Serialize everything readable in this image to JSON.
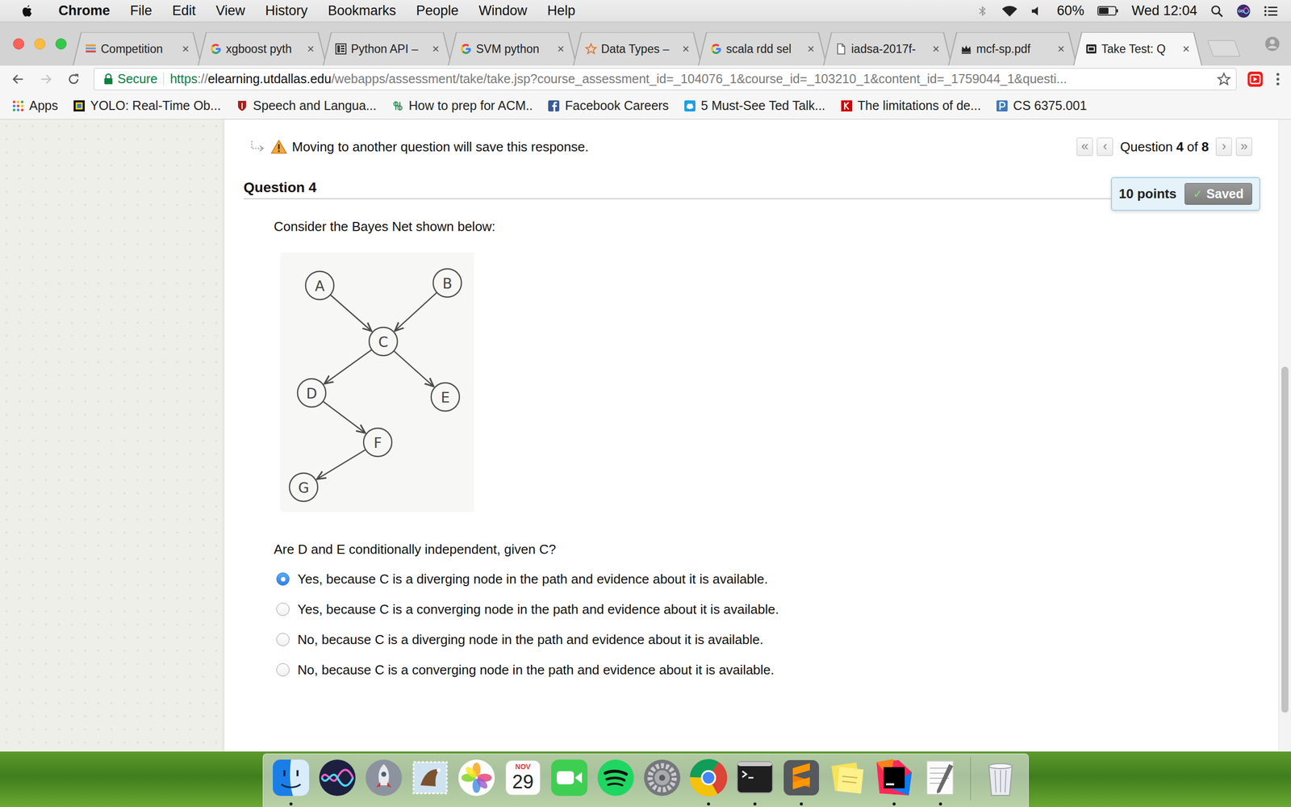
{
  "menu_bar": {
    "app_name": "Chrome",
    "menus": [
      "File",
      "Edit",
      "View",
      "History",
      "Bookmarks",
      "People",
      "Window",
      "Help"
    ],
    "battery": "60%",
    "battery_level": 0.6,
    "clock": "Wed 12:04"
  },
  "tab_close": "×",
  "tabs": [
    {
      "label": "Competition",
      "kind": "kaggle",
      "selected": false
    },
    {
      "label": "xgboost pyth",
      "kind": "google",
      "selected": false
    },
    {
      "label": "Python API –",
      "kind": "docs",
      "selected": false
    },
    {
      "label": "SVM python",
      "kind": "google",
      "selected": false
    },
    {
      "label": "Data Types –",
      "kind": "star",
      "selected": false
    },
    {
      "label": "scala rdd sel",
      "kind": "google",
      "selected": false
    },
    {
      "label": "iadsa-2017f-",
      "kind": "file",
      "selected": false
    },
    {
      "label": "mcf-sp.pdf",
      "kind": "crown",
      "selected": false
    },
    {
      "label": "Take Test: Q",
      "kind": "blackboard",
      "selected": true
    }
  ],
  "toolbar": {
    "secure_label": "Secure",
    "url_scheme": "https",
    "url_separator": "://",
    "url_host": "elearning.utdallas.edu",
    "url_rest": "/webapps/assessment/take/take.jsp?course_assessment_id=_104076_1&course_id=_103210_1&content_id=_1759044_1&questi..."
  },
  "bookmarks": [
    {
      "label": "Apps",
      "kind": "apps"
    },
    {
      "label": "YOLO: Real-Time Ob...",
      "kind": "yolo"
    },
    {
      "label": "Speech and Langua...",
      "kind": "stanford"
    },
    {
      "label": "How to prep for ACM..",
      "kind": "knot"
    },
    {
      "label": "Facebook Careers",
      "kind": "facebook"
    },
    {
      "label": "5 Must-See Ted Talk...",
      "kind": "cloud"
    },
    {
      "label": "The limitations of de...",
      "kind": "keras"
    },
    {
      "label": "CS 6375.001",
      "kind": "piazza"
    }
  ],
  "page": {
    "notice": "Moving to another question will save this response.",
    "nav": {
      "first": "«",
      "prev": "‹",
      "prefix": "Question",
      "current": "4",
      "of": "of",
      "total": "8",
      "next": "›",
      "last": "»"
    },
    "question_title": "Question 4",
    "points": "10 points",
    "saved_check": "✓",
    "saved_label": "Saved",
    "prompt": "Consider the Bayes Net shown below:",
    "diagram": {
      "nodes": [
        "A",
        "B",
        "C",
        "D",
        "E",
        "F",
        "G"
      ],
      "edges": [
        [
          "A",
          "C"
        ],
        [
          "B",
          "C"
        ],
        [
          "C",
          "D"
        ],
        [
          "C",
          "E"
        ],
        [
          "D",
          "F"
        ],
        [
          "F",
          "G"
        ]
      ]
    },
    "question": "Are D and E conditionally independent, given C?",
    "options": [
      {
        "label": "Yes, because C is a diverging node in the path and evidence about it is available.",
        "selected": true
      },
      {
        "label": "Yes, because C is a converging node in the path and evidence about it is available.",
        "selected": false
      },
      {
        "label": "No, because C is a diverging node in the path and evidence about it is available.",
        "selected": false
      },
      {
        "label": "No, because C is a converging node in the path and evidence about it is available.",
        "selected": false
      }
    ]
  },
  "dock": [
    {
      "kind": "finder",
      "running": true
    },
    {
      "kind": "siri",
      "running": false
    },
    {
      "kind": "launchpad",
      "running": false
    },
    {
      "kind": "mail",
      "running": false
    },
    {
      "kind": "photos",
      "running": false
    },
    {
      "kind": "calendar",
      "running": false,
      "month": "NOV",
      "day": "29"
    },
    {
      "kind": "facetime",
      "running": false
    },
    {
      "kind": "spotify",
      "running": false
    },
    {
      "kind": "preferences",
      "running": false
    },
    {
      "kind": "chrome",
      "running": true
    },
    {
      "kind": "terminal",
      "running": true
    },
    {
      "kind": "sublime",
      "running": true
    },
    {
      "kind": "stickies",
      "running": false
    },
    {
      "kind": "intellij",
      "running": true
    },
    {
      "kind": "textedit",
      "running": true
    },
    {
      "kind": "trash",
      "running": false
    }
  ]
}
